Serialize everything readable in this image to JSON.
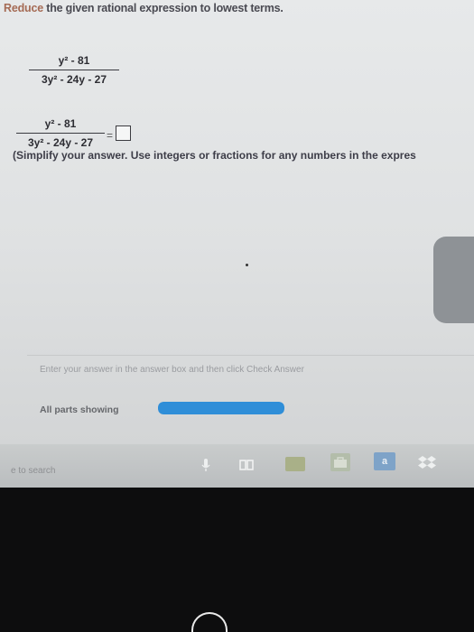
{
  "question": {
    "prompt": "Reduce the given rational expression to lowest terms.",
    "expression": {
      "numerator": "y² - 81",
      "denominator": "3y² - 24y - 27"
    },
    "equals": "=",
    "instruction": "(Simplify your answer. Use integers or fractions for any numbers in the expres"
  },
  "footer": {
    "message": "Enter your answer in the answer box and then click Check Answer",
    "parts_label": "All parts showing",
    "progress": 1.0
  },
  "taskbar": {
    "search_text": "e to search",
    "amazon_label": "a",
    "icons": [
      "microphone-icon",
      "task-view-icon",
      "file-explorer-icon",
      "store-icon",
      "amazon-icon",
      "dropbox-icon"
    ]
  },
  "colors": {
    "accent": "#2f8ed8",
    "text": "#3d3d48"
  }
}
